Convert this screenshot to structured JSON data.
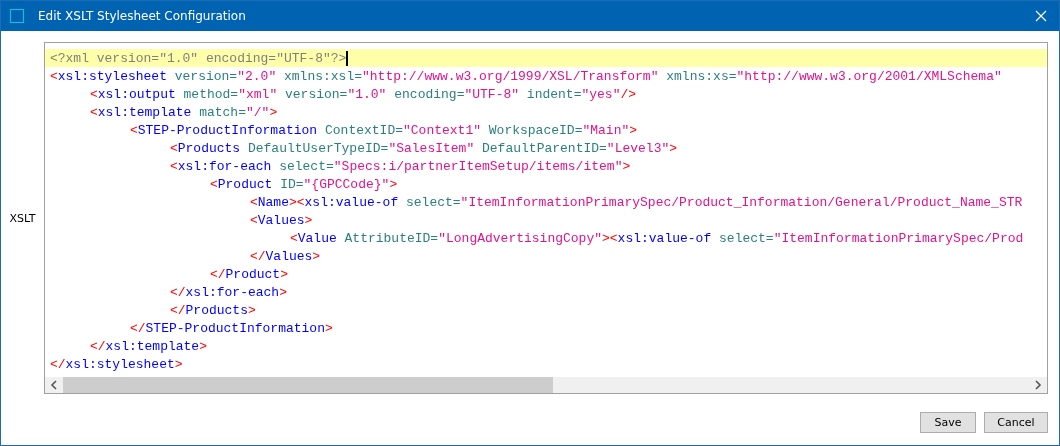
{
  "window": {
    "title": "Edit XSLT Stylesheet Configuration"
  },
  "field_label": "XSLT",
  "editor": {
    "lines": [
      {
        "highlighted": true,
        "tokens": [
          {
            "kind": "decl",
            "text": "<?xml version=\"1.0\" encoding=\"UTF-8\"?>"
          }
        ]
      },
      {
        "highlighted": false,
        "tokens": [
          {
            "kind": "punct",
            "text": "<"
          },
          {
            "kind": "tag",
            "text": "xsl:stylesheet"
          },
          {
            "kind": "attr",
            "text": " version="
          },
          {
            "kind": "value",
            "text": "\"2.0\""
          },
          {
            "kind": "attr",
            "text": " xmlns:xsl="
          },
          {
            "kind": "value",
            "text": "\"http://www.w3.org/1999/XSL/Transform\""
          },
          {
            "kind": "attr",
            "text": " xmlns:xs="
          },
          {
            "kind": "value",
            "text": "\"http://www.w3.org/2001/XMLSchema\""
          }
        ],
        "children": [
          {
            "highlighted": false,
            "tokens": [
              {
                "kind": "punct",
                "text": "<"
              },
              {
                "kind": "tag",
                "text": "xsl:output"
              },
              {
                "kind": "attr",
                "text": " method="
              },
              {
                "kind": "value",
                "text": "\"xml\""
              },
              {
                "kind": "attr",
                "text": " version="
              },
              {
                "kind": "value",
                "text": "\"1.0\""
              },
              {
                "kind": "attr",
                "text": " encoding="
              },
              {
                "kind": "value",
                "text": "\"UTF-8\""
              },
              {
                "kind": "attr",
                "text": " indent="
              },
              {
                "kind": "value",
                "text": "\"yes\""
              },
              {
                "kind": "punct",
                "text": "/>"
              }
            ]
          },
          {
            "highlighted": false,
            "tokens": [
              {
                "kind": "punct",
                "text": "<"
              },
              {
                "kind": "tag",
                "text": "xsl:template"
              },
              {
                "kind": "attr",
                "text": " match="
              },
              {
                "kind": "value",
                "text": "\"/\""
              },
              {
                "kind": "punct",
                "text": ">"
              }
            ],
            "children": [
              {
                "highlighted": false,
                "tokens": [
                  {
                    "kind": "punct",
                    "text": "<"
                  },
                  {
                    "kind": "tag",
                    "text": "STEP-ProductInformation"
                  },
                  {
                    "kind": "attr",
                    "text": " ContextID="
                  },
                  {
                    "kind": "value",
                    "text": "\"Context1\""
                  },
                  {
                    "kind": "attr",
                    "text": " WorkspaceID="
                  },
                  {
                    "kind": "value",
                    "text": "\"Main\""
                  },
                  {
                    "kind": "punct",
                    "text": ">"
                  }
                ],
                "children": [
                  {
                    "highlighted": false,
                    "tokens": [
                      {
                        "kind": "punct",
                        "text": "<"
                      },
                      {
                        "kind": "tag",
                        "text": "Products"
                      },
                      {
                        "kind": "attr",
                        "text": " DefaultUserTypeID="
                      },
                      {
                        "kind": "value",
                        "text": "\"SalesItem\""
                      },
                      {
                        "kind": "attr",
                        "text": " DefaultParentID="
                      },
                      {
                        "kind": "value",
                        "text": "\"Level3\""
                      },
                      {
                        "kind": "punct",
                        "text": ">"
                      }
                    ]
                  },
                  {
                    "highlighted": false,
                    "tokens": [
                      {
                        "kind": "punct",
                        "text": "<"
                      },
                      {
                        "kind": "tag",
                        "text": "xsl:for-each"
                      },
                      {
                        "kind": "attr",
                        "text": " select="
                      },
                      {
                        "kind": "value",
                        "text": "\"Specs:i/partnerItemSetup/items/item\""
                      },
                      {
                        "kind": "punct",
                        "text": ">"
                      }
                    ],
                    "children": [
                      {
                        "highlighted": false,
                        "tokens": [
                          {
                            "kind": "punct",
                            "text": "<"
                          },
                          {
                            "kind": "tag",
                            "text": "Product"
                          },
                          {
                            "kind": "attr",
                            "text": " ID="
                          },
                          {
                            "kind": "value",
                            "text": "\"{GPCCode}\""
                          },
                          {
                            "kind": "punct",
                            "text": ">"
                          }
                        ],
                        "children": [
                          {
                            "highlighted": false,
                            "tokens": [
                              {
                                "kind": "punct",
                                "text": "<"
                              },
                              {
                                "kind": "tag",
                                "text": "Name"
                              },
                              {
                                "kind": "punct",
                                "text": "><"
                              },
                              {
                                "kind": "tag",
                                "text": "xsl:value-of"
                              },
                              {
                                "kind": "attr",
                                "text": " select="
                              },
                              {
                                "kind": "value",
                                "text": "\"ItemInformationPrimarySpec/Product_Information/General/Product_Name_STR"
                              }
                            ]
                          },
                          {
                            "highlighted": false,
                            "tokens": [
                              {
                                "kind": "punct",
                                "text": "<"
                              },
                              {
                                "kind": "tag",
                                "text": "Values"
                              },
                              {
                                "kind": "punct",
                                "text": ">"
                              }
                            ],
                            "children": [
                              {
                                "highlighted": false,
                                "tokens": [
                                  {
                                    "kind": "punct",
                                    "text": "<"
                                  },
                                  {
                                    "kind": "tag",
                                    "text": "Value"
                                  },
                                  {
                                    "kind": "attr",
                                    "text": " AttributeID="
                                  },
                                  {
                                    "kind": "value",
                                    "text": "\"LongAdvertisingCopy\""
                                  },
                                  {
                                    "kind": "punct",
                                    "text": "><"
                                  },
                                  {
                                    "kind": "tag",
                                    "text": "xsl:value-of"
                                  },
                                  {
                                    "kind": "attr",
                                    "text": " select="
                                  },
                                  {
                                    "kind": "value",
                                    "text": "\"ItemInformationPrimarySpec/Prod"
                                  }
                                ]
                              }
                            ]
                          },
                          {
                            "highlighted": false,
                            "tokens": [
                              {
                                "kind": "punct",
                                "text": "</"
                              },
                              {
                                "kind": "tag",
                                "text": "Values"
                              },
                              {
                                "kind": "punct",
                                "text": ">"
                              }
                            ]
                          }
                        ]
                      },
                      {
                        "highlighted": false,
                        "tokens": [
                          {
                            "kind": "punct",
                            "text": "</"
                          },
                          {
                            "kind": "tag",
                            "text": "Product"
                          },
                          {
                            "kind": "punct",
                            "text": ">"
                          }
                        ]
                      }
                    ]
                  },
                  {
                    "highlighted": false,
                    "tokens": [
                      {
                        "kind": "punct",
                        "text": "</"
                      },
                      {
                        "kind": "tag",
                        "text": "xsl:for-each"
                      },
                      {
                        "kind": "punct",
                        "text": ">"
                      }
                    ]
                  },
                  {
                    "highlighted": false,
                    "tokens": [
                      {
                        "kind": "punct",
                        "text": "</"
                      },
                      {
                        "kind": "tag",
                        "text": "Products"
                      },
                      {
                        "kind": "punct",
                        "text": ">"
                      }
                    ]
                  }
                ]
              },
              {
                "highlighted": false,
                "tokens": [
                  {
                    "kind": "punct",
                    "text": "</"
                  },
                  {
                    "kind": "tag",
                    "text": "STEP-ProductInformation"
                  },
                  {
                    "kind": "punct",
                    "text": ">"
                  }
                ]
              }
            ]
          },
          {
            "highlighted": false,
            "tokens": [
              {
                "kind": "punct",
                "text": "</"
              },
              {
                "kind": "tag",
                "text": "xsl:template"
              },
              {
                "kind": "punct",
                "text": ">"
              }
            ]
          }
        ]
      },
      {
        "highlighted": false,
        "tokens": [
          {
            "kind": "punct",
            "text": "</"
          },
          {
            "kind": "tag",
            "text": "xsl:stylesheet"
          },
          {
            "kind": "punct",
            "text": ">"
          }
        ]
      }
    ]
  },
  "buttons": [
    {
      "label": "Save"
    },
    {
      "label": "Cancel"
    }
  ]
}
